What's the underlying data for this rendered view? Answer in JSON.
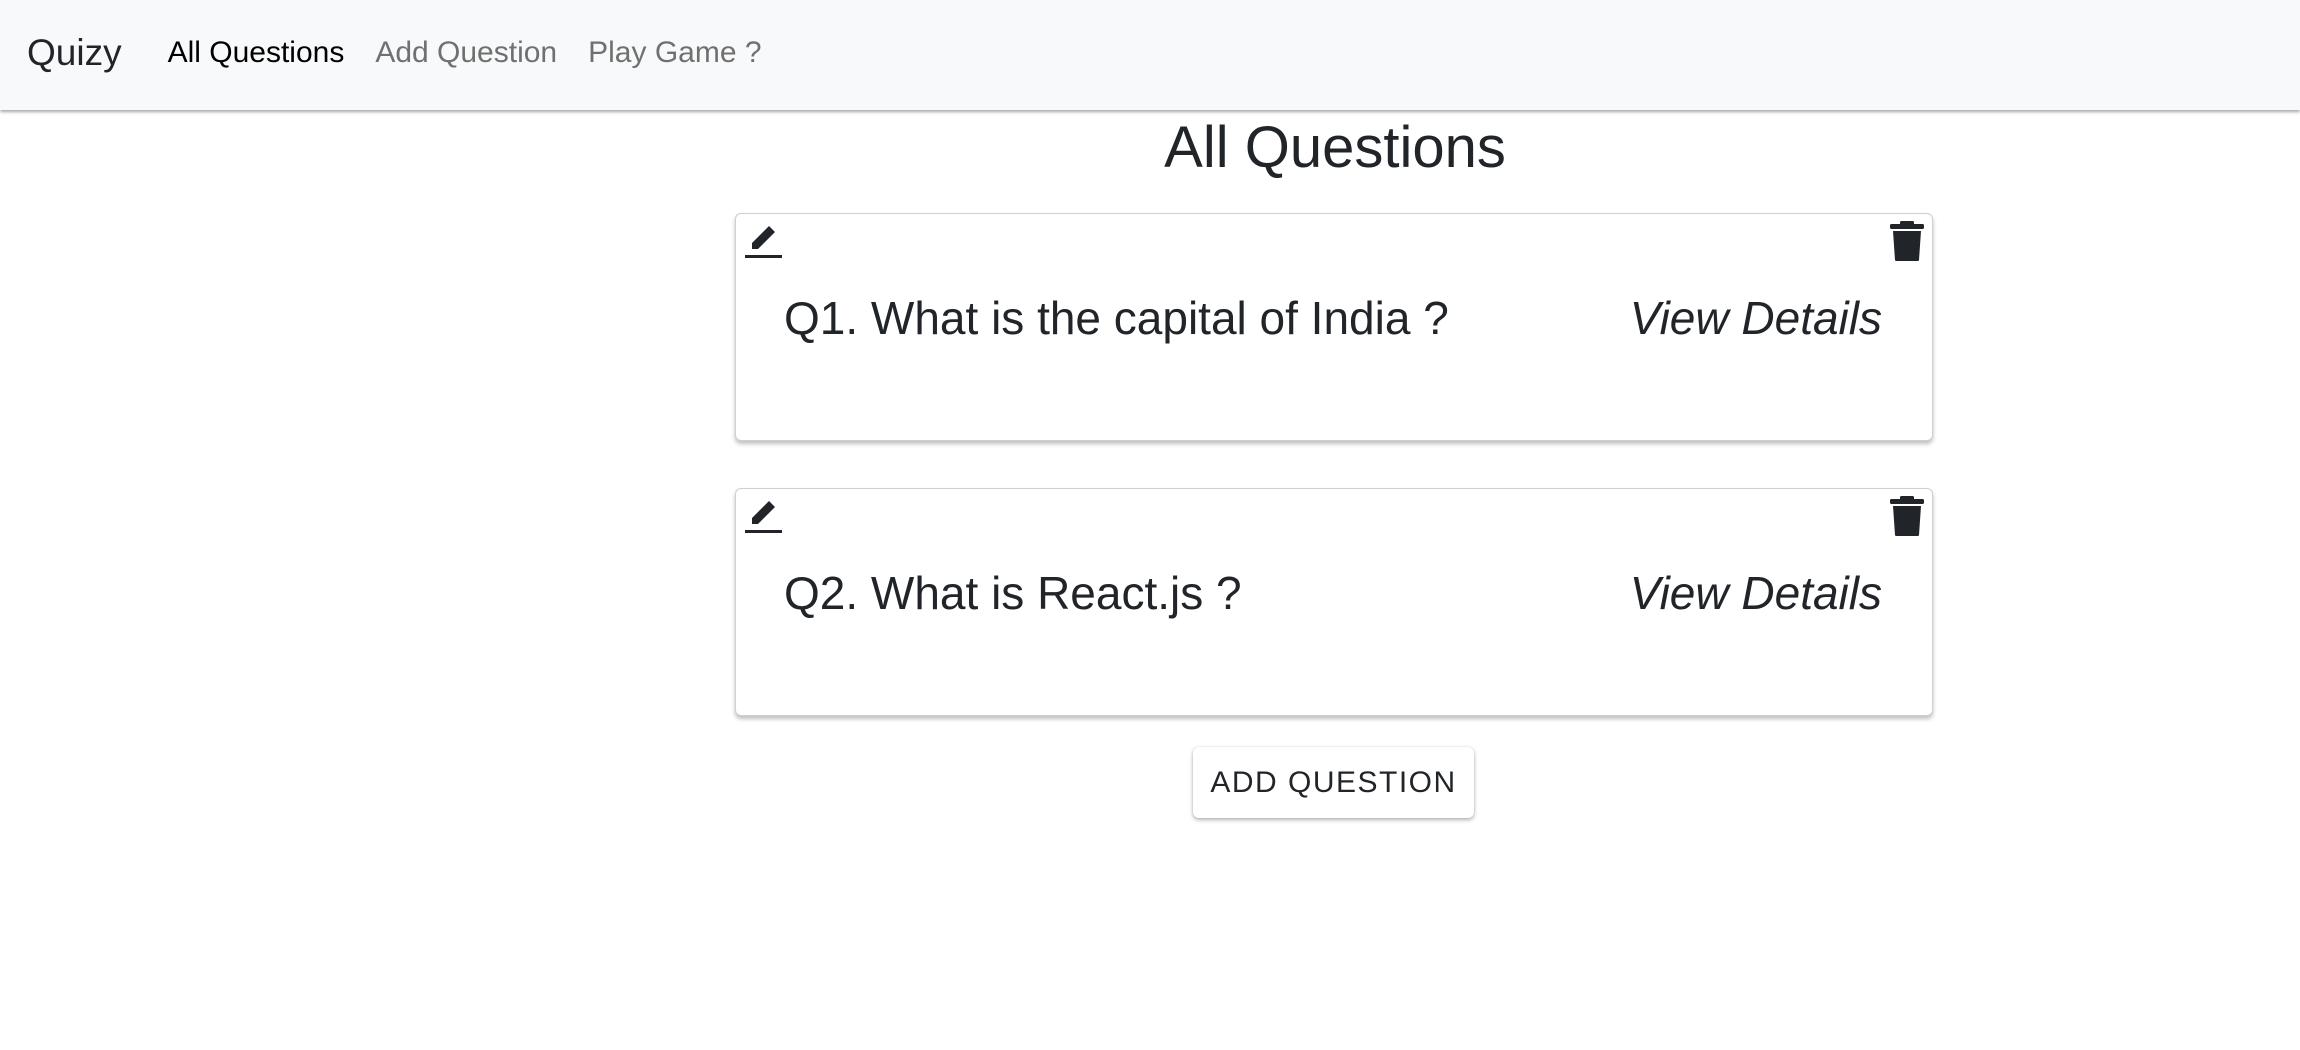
{
  "navbar": {
    "brand": "Quizy",
    "links": [
      {
        "label": "All Questions",
        "active": true
      },
      {
        "label": "Add Question",
        "active": false
      },
      {
        "label": "Play Game ?",
        "active": false
      }
    ]
  },
  "main": {
    "title": "All Questions",
    "questions": [
      {
        "text": "Q1. What is the capital of India ?",
        "details_label": "View Details",
        "edit_icon": "pencil-icon",
        "delete_icon": "trash-icon"
      },
      {
        "text": "Q2. What is React.js ?",
        "details_label": "View Details",
        "edit_icon": "pencil-icon",
        "delete_icon": "trash-icon"
      }
    ],
    "add_button_label": "ADD QUESTION"
  },
  "colors": {
    "navbar_bg": "#f8f9fa",
    "text": "#212529",
    "nav_inactive": "#707070",
    "card_border": "#cfcfcf"
  }
}
